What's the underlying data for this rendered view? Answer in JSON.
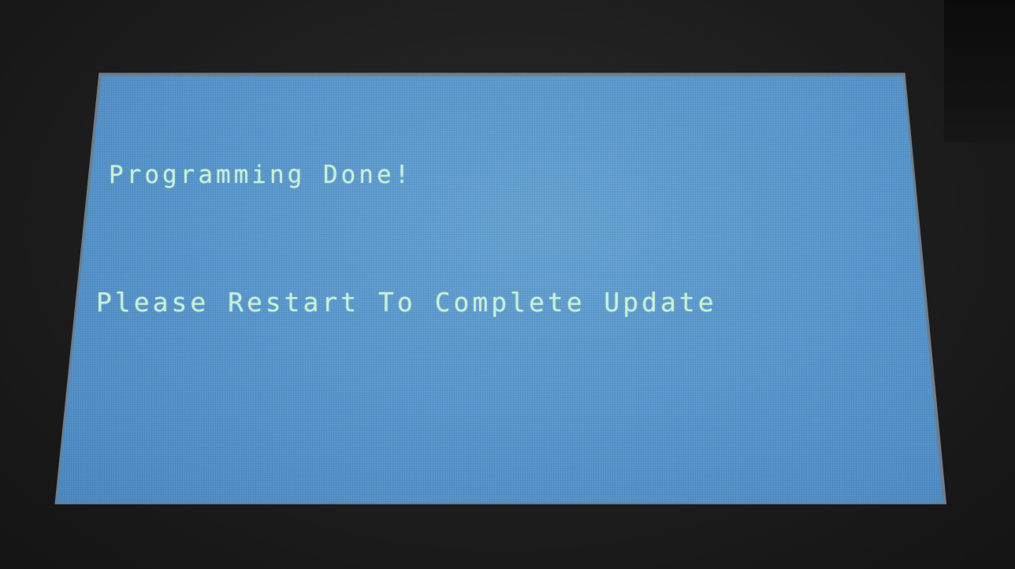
{
  "screen": {
    "line_1": "Programming Done!",
    "line_2": "Please Restart To Complete Update"
  },
  "colors": {
    "bezel": "#1d1d1d",
    "lcd_background": "#5c9bd0",
    "lcd_text": "#c8f0d8"
  }
}
